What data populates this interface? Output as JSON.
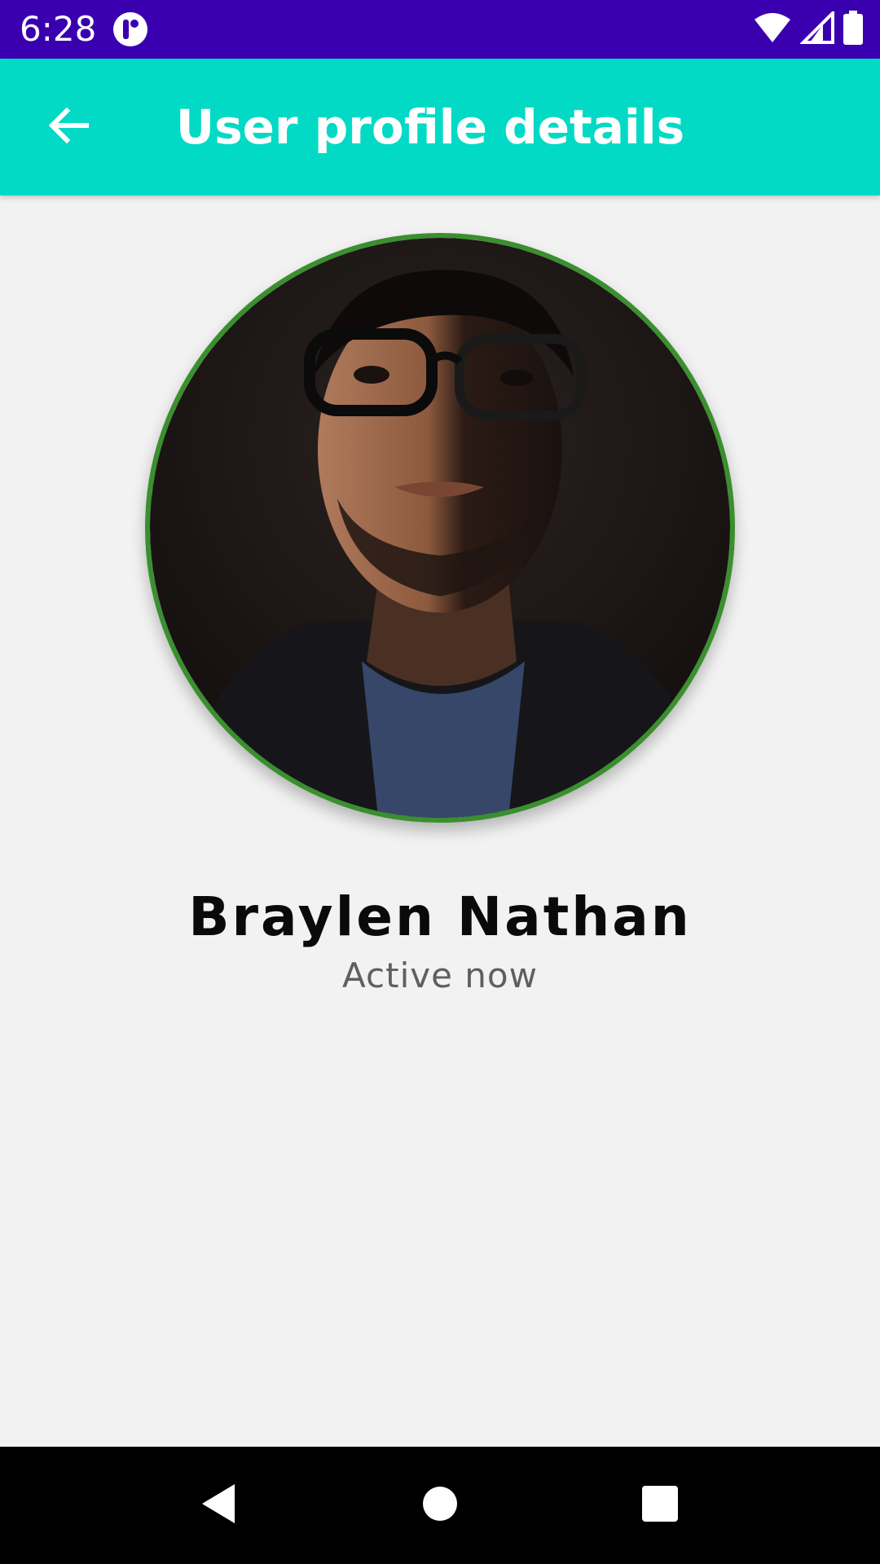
{
  "status_bar": {
    "time": "6:28",
    "background_color": "#3a00b0",
    "icons": [
      "notification-app-icon",
      "wifi-icon",
      "cellular-signal-icon",
      "battery-icon"
    ]
  },
  "app_bar": {
    "title": "User profile details",
    "background_color": "#03dac5",
    "back_icon": "arrow-back-icon"
  },
  "profile": {
    "avatar_icon": "avatar-photo",
    "avatar_border_color": "#3a8f2e",
    "name": "Braylen Nathan",
    "status": "Active now"
  },
  "nav_bar": {
    "buttons": [
      "nav-back-icon",
      "nav-home-icon",
      "nav-recents-icon"
    ]
  }
}
